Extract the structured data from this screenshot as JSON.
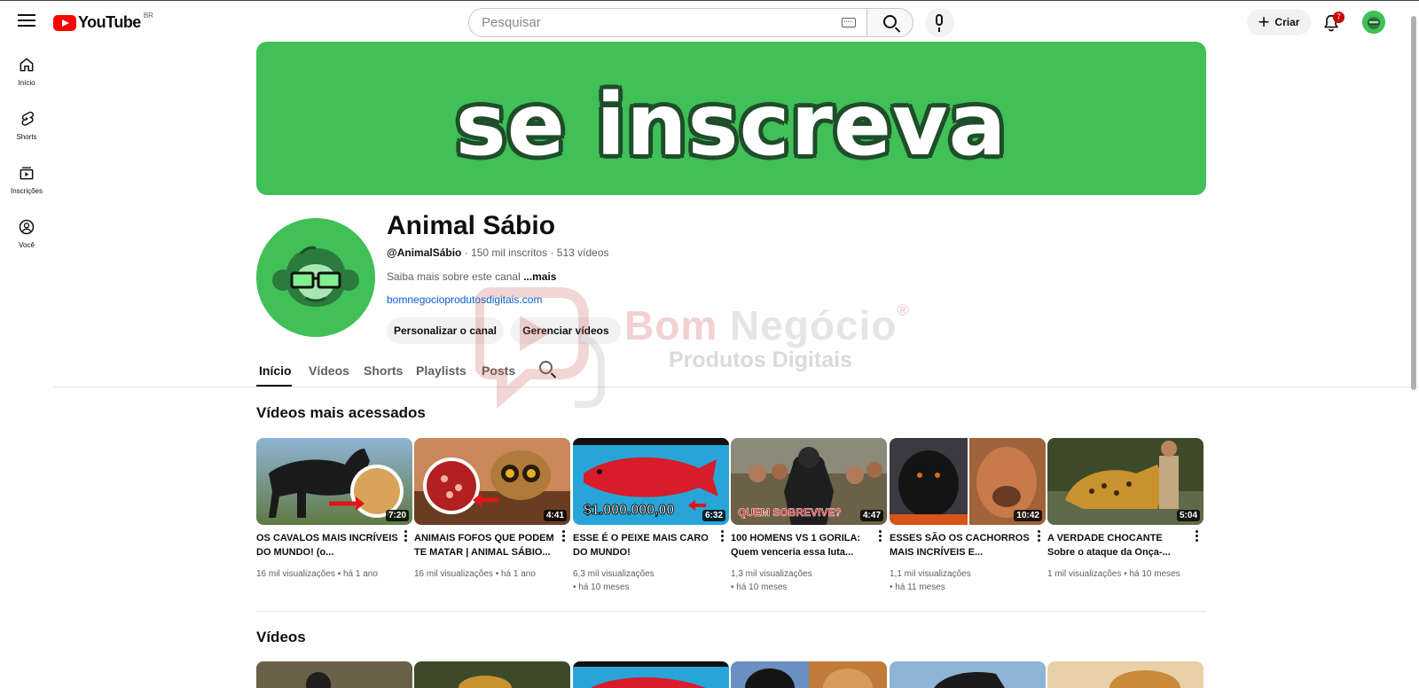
{
  "topbar": {
    "brand": "YouTube",
    "country_code": "BR",
    "search_placeholder": "Pesquisar",
    "create_label": "Criar",
    "notifications_count": "7"
  },
  "sidebar": {
    "items": [
      {
        "label": "Início",
        "icon": "home-icon"
      },
      {
        "label": "Shorts",
        "icon": "shorts-icon"
      },
      {
        "label": "Inscrições",
        "icon": "subscriptions-icon"
      },
      {
        "label": "Você",
        "icon": "you-icon"
      }
    ]
  },
  "banner": {
    "text": "se inscreva",
    "color": "#40c057"
  },
  "channel": {
    "name": "Animal Sábio",
    "handle": "@AnimalSábio",
    "subscribers": "150 mil inscritos",
    "video_count": "513 vídeos",
    "description": "Saiba mais sobre este canal",
    "more_label": "...mais",
    "link": "bomnegocioprodutosdigitais.com",
    "buttons": {
      "customize": "Personalizar o canal",
      "manage": "Gerenciar vídeos"
    }
  },
  "tabs": [
    {
      "label": "Início",
      "active": true
    },
    {
      "label": "Vídeos",
      "active": false
    },
    {
      "label": "Shorts",
      "active": false
    },
    {
      "label": "Playlists",
      "active": false
    },
    {
      "label": "Posts",
      "active": false
    }
  ],
  "watermark": {
    "title_part1": "Bom",
    "title_part2": "Negócio",
    "registered": "®",
    "subtitle": "Produtos Digitais"
  },
  "sections": {
    "popular_title": "Vídeos mais acessados",
    "videos_title": "Vídeos"
  },
  "popular_videos": [
    {
      "title": "OS CAVALOS MAIS INCRÍVEIS DO MUNDO! (o...",
      "duration": "7:20",
      "views": "16 mil visualizações",
      "age": "há 1 ano",
      "thumb_text": ""
    },
    {
      "title": "ANIMAIS FOFOS QUE PODEM TE MATAR | ANIMAL SÁBIO...",
      "duration": "4:41",
      "views": "16 mil visualizações",
      "age": "há 1 ano",
      "thumb_text": ""
    },
    {
      "title": "ESSE É O PEIXE MAIS CARO DO MUNDO!",
      "duration": "6:32",
      "views": "6,3 mil visualizações",
      "age": "há 10 meses",
      "thumb_text": "$1.000.000,00"
    },
    {
      "title": "100 HOMENS VS 1 GORILA: Quem venceria essa luta...",
      "duration": "4:47",
      "views": "1,3 mil visualizações",
      "age": "há 10 meses",
      "thumb_text": "QUEM SOBREVIVE?"
    },
    {
      "title": "ESSES SÃO OS CACHORROS MAIS INCRÍVEIS E...",
      "duration": "10:42",
      "views": "1,1 mil visualizações",
      "age": "há 11 meses",
      "thumb_text": ""
    },
    {
      "title": "A VERDADE CHOCANTE Sobre o ataque da Onça-...",
      "duration": "5:04",
      "views": "1 mil visualizações",
      "age": "há 10 meses",
      "thumb_text": ""
    }
  ]
}
